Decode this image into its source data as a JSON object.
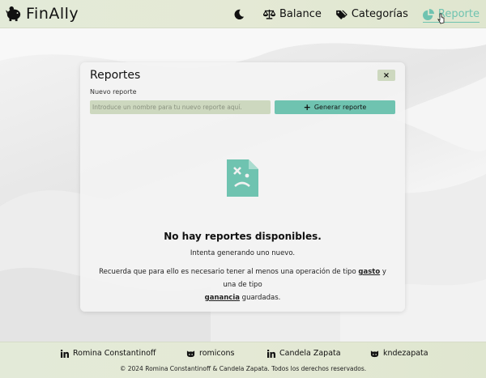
{
  "app": {
    "brand": "FinAlly"
  },
  "nav": {
    "items": [
      {
        "label": "Balance",
        "icon": "scale-icon"
      },
      {
        "label": "Categorías",
        "icon": "tags-icon"
      },
      {
        "label": "Reporte",
        "icon": "pie-chart-icon",
        "active": true
      }
    ],
    "theme_toggle": "moon-icon"
  },
  "report_panel": {
    "title": "Reportes",
    "close_label": "×",
    "form_label": "Nuevo reporte",
    "input_placeholder": "Introduce un nombre para tu nuevo reporte aquí.",
    "input_value": "",
    "generate_label": "Generar reporte"
  },
  "empty_state": {
    "title": "No hay reportes disponibles.",
    "subtitle": "Intenta generando uno nuevo.",
    "note_before": "Recuerda que para ello es necesario tener al menos una operación de tipo ",
    "note_gasto": "gasto",
    "note_middle": " y una de tipo ",
    "note_ganancia": "ganancia",
    "note_after": " guardadas."
  },
  "footer": {
    "links": [
      {
        "label": "Romina Constantinoff",
        "icon": "linkedin-icon"
      },
      {
        "label": "romicons",
        "icon": "github-icon"
      },
      {
        "label": "Candela Zapata",
        "icon": "linkedin-icon"
      },
      {
        "label": "kndezapata",
        "icon": "github-icon"
      }
    ],
    "copyright": "© 2024 Romina Constantinoff & Candela Zapata. Todos los derechos reservados."
  },
  "colors": {
    "accent": "#6fc3b0",
    "navbar": "#e3ead8",
    "input_bg": "#cdd8bf"
  }
}
